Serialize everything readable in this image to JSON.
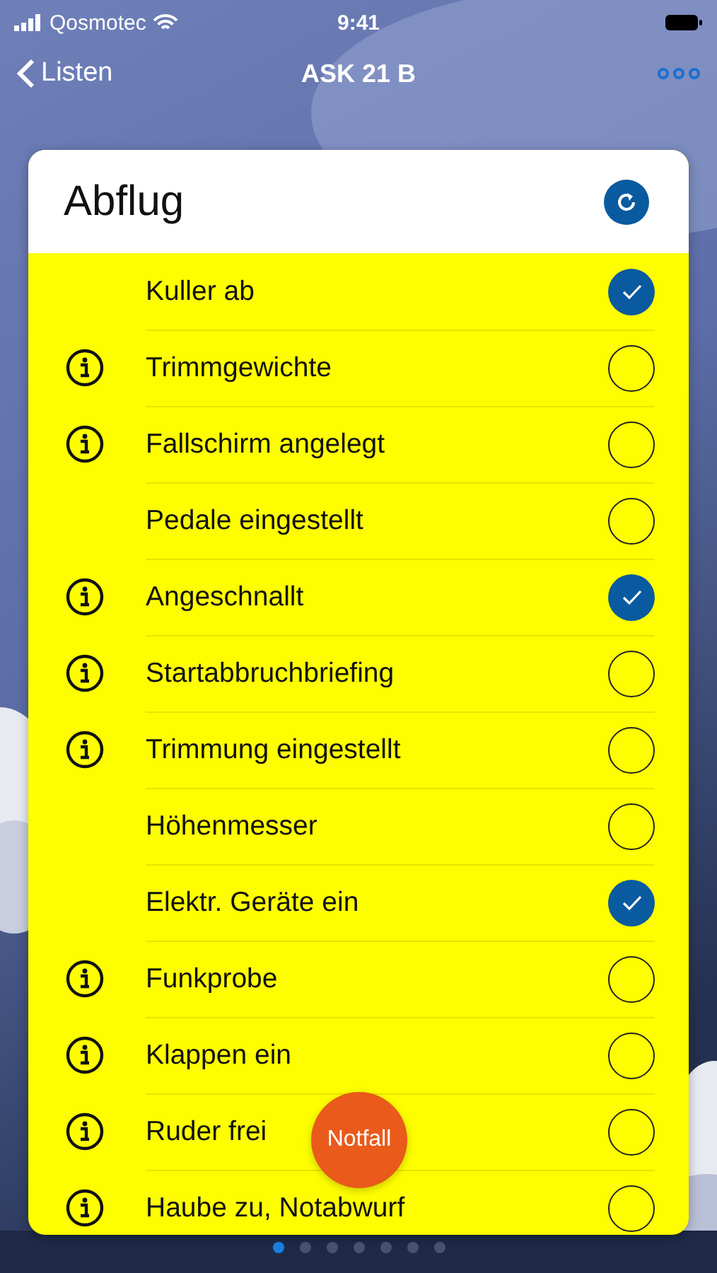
{
  "status_bar": {
    "carrier": "Qosmotec",
    "time": "9:41"
  },
  "nav": {
    "back": "Listen",
    "title": "ASK 21 B"
  },
  "card": {
    "title": "Abflug",
    "items": [
      {
        "label": "Kuller ab",
        "info": false,
        "checked": true
      },
      {
        "label": "Trimmgewichte",
        "info": true,
        "checked": false
      },
      {
        "label": "Fallschirm angelegt",
        "info": true,
        "checked": false
      },
      {
        "label": "Pedale eingestellt",
        "info": false,
        "checked": false
      },
      {
        "label": "Angeschnallt",
        "info": true,
        "checked": true
      },
      {
        "label": "Startabbruchbriefing",
        "info": true,
        "checked": false
      },
      {
        "label": "Trimmung eingestellt",
        "info": true,
        "checked": false
      },
      {
        "label": "Höhenmesser",
        "info": false,
        "checked": false
      },
      {
        "label": "Elektr. Geräte ein",
        "info": false,
        "checked": true
      },
      {
        "label": "Funkprobe",
        "info": true,
        "checked": false
      },
      {
        "label": "Klappen ein",
        "info": true,
        "checked": false
      },
      {
        "label": "Ruder frei",
        "info": true,
        "checked": false
      },
      {
        "label": "Haube zu, Notabwurf",
        "info": true,
        "checked": false
      }
    ]
  },
  "emergency_button": "Notfall",
  "pages": [
    {
      "selected": true
    },
    {
      "selected": false
    },
    {
      "selected": false
    },
    {
      "selected": false
    },
    {
      "selected": false
    },
    {
      "selected": false
    },
    {
      "selected": false
    }
  ]
}
